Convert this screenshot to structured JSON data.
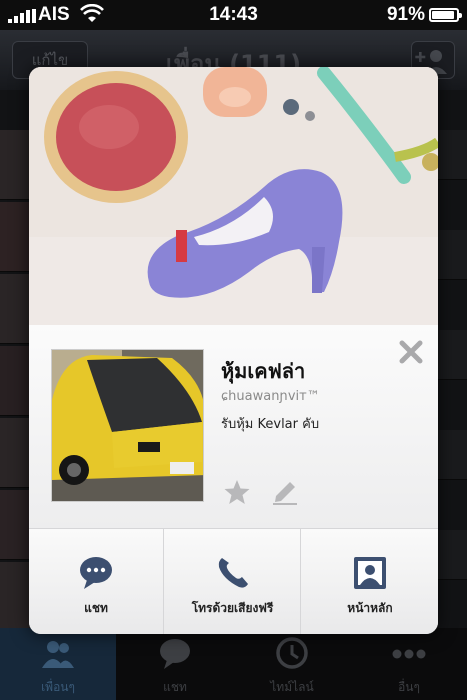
{
  "status_bar": {
    "carrier": "AIS",
    "time": "14:43",
    "battery": "91%",
    "battery_level": 0.91
  },
  "navbar": {
    "edit_label": "แก้ไข",
    "title": "เพื่อน (111)"
  },
  "profile": {
    "name": "หุ้มเคฟล่า",
    "id_text": "ɕhuawanɲviт™",
    "status_message": "รับหุ้ม Kevlar คับ"
  },
  "actions": [
    {
      "label": "แชท",
      "icon": "chat-bubble-icon"
    },
    {
      "label": "โทรด้วยเสียงฟรี",
      "icon": "phone-icon"
    },
    {
      "label": "หน้าหลัก",
      "icon": "home-profile-icon"
    }
  ],
  "tabs": [
    {
      "label": "เพื่อนๆ",
      "icon": "friends-icon"
    },
    {
      "label": "แชท",
      "icon": "chat-icon"
    },
    {
      "label": "ไทม์ไลน์",
      "icon": "clock-icon"
    },
    {
      "label": "อื่นๆ",
      "icon": "more-icon"
    }
  ],
  "colors": {
    "accent": "#3a5a78",
    "overlay": "#000000",
    "card": "#f5f5f6"
  }
}
